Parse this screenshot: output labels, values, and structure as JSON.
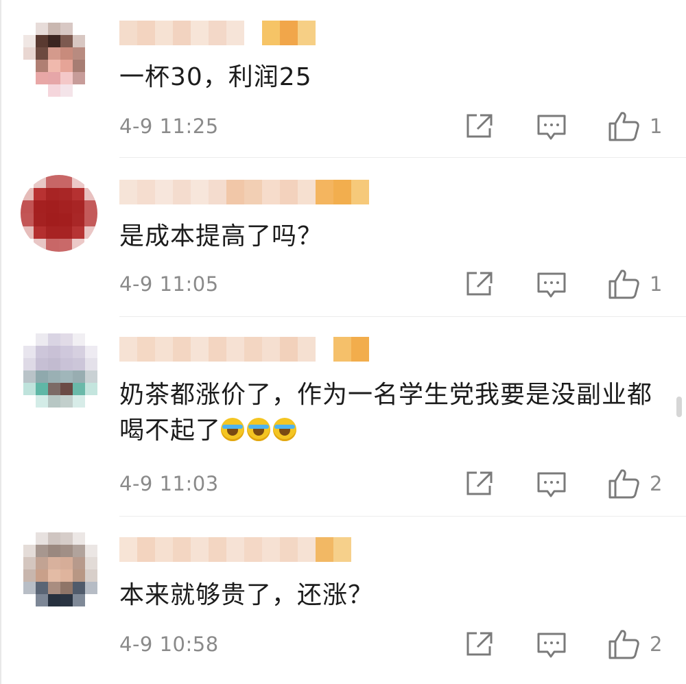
{
  "comments": [
    {
      "text": "一杯30，利润25",
      "time": "4-9 11:25",
      "likes": "1",
      "avatar_colors": [
        "#ffffff",
        "#e7dcd9",
        "#c9b7b0",
        "#d8c8c4",
        "#ffffff",
        "#ffffff",
        "#f0e7e4",
        "#5a3a31",
        "#3b2520",
        "#7d5a50",
        "#d8c7c2",
        "#ffffff",
        "#e9d7d2",
        "#6d4a40",
        "#d49a8c",
        "#c88b7c",
        "#b88b80",
        "#ffffff",
        "#ffffff",
        "#b07f73",
        "#f0b9ad",
        "#e6a497",
        "#a77d73",
        "#ffffff",
        "#ffffff",
        "#e8a7a6",
        "#e6a6a8",
        "#f4c8c8",
        "#c79c99",
        "#ffffff",
        "#ffffff",
        "#ffffff",
        "#f5d6dc",
        "#f4e4e9",
        "#ffffff",
        "#ffffff"
      ],
      "name_colors": [
        "#f4dccb",
        "#f3d4c0",
        "#f6e2d3",
        "#f2d3c0",
        "#f7e5d8",
        "#f3d8c8",
        "#f6e4d8",
        "#ffffff",
        "#f6c466",
        "#f1a64a",
        "#f6cf85"
      ]
    },
    {
      "text": "是成本提高了吗？",
      "time": "4-9 11:05",
      "likes": "1",
      "avatar_colors": [
        "#ffffff",
        "#e8c8c6",
        "#c76666",
        "#c86666",
        "#ecc9c8",
        "#ffffff",
        "#e5bbb8",
        "#b83232",
        "#a82424",
        "#a92626",
        "#b53131",
        "#e8c0bf",
        "#c25353",
        "#a52020",
        "#a31e1e",
        "#a52121",
        "#a82525",
        "#c45a5a",
        "#c35656",
        "#a52121",
        "#a21d1d",
        "#a31e1e",
        "#a92727",
        "#c45a5a",
        "#e6bdbb",
        "#b42f2f",
        "#a72323",
        "#a72323",
        "#b63434",
        "#eac6c5",
        "#ffffff",
        "#e8c6c5",
        "#c86767",
        "#c96969",
        "#ecc9c8",
        "#ffffff"
      ],
      "name_colors": [
        "#f6e4d8",
        "#f5ddcf",
        "#f7e6dc",
        "#f4dcce",
        "#f7e6db",
        "#f4dcce",
        "#f1c7a8",
        "#f2cfb4",
        "#f6dccb",
        "#f3d2bd",
        "#f6e0d0",
        "#f4b55f",
        "#f2ae4e",
        "#f6c97a"
      ]
    },
    {
      "text": "奶茶都涨价了，作为一名学生党我要是没副业都喝不起了",
      "emoji_count": 3,
      "time": "4-9 11:03",
      "likes": "2",
      "avatar_colors": [
        "#ffffff",
        "#eceaf0",
        "#d9d4e3",
        "#e1dbe7",
        "#f1eff3",
        "#ffffff",
        "#e8e5ee",
        "#cdc6da",
        "#c9c1d6",
        "#cfc8dc",
        "#d6d0e0",
        "#eeebf2",
        "#dedae6",
        "#c6bfd4",
        "#c2bbd0",
        "#c9c2d7",
        "#ccc6d9",
        "#e4e1ea",
        "#b9c3c8",
        "#8fa9ad",
        "#9ab0b4",
        "#a0b6ba",
        "#98adb1",
        "#c9d1d4",
        "#bfe3dc",
        "#5fb7a6",
        "#7c6a66",
        "#6b4a45",
        "#6ab9a9",
        "#c4e5de",
        "#ffffff",
        "#d3ece7",
        "#b7c7c4",
        "#c2cfcc",
        "#d7ece8",
        "#ffffff"
      ],
      "name_colors": [
        "#f6e2d4",
        "#f4d8c4",
        "#f6e1d2",
        "#f3d6c2",
        "#f6e3d6",
        "#f3d5c1",
        "#f6e1d3",
        "#f3d6c2",
        "#f5dfd0",
        "#f2d1bb",
        "#f5e0d1",
        "#ffffff",
        "#f5c06a",
        "#f2ad4c"
      ]
    },
    {
      "text": "本来就够贵了，还涨？",
      "time": "4-9 10:58",
      "likes": "2",
      "avatar_colors": [
        "#ffffff",
        "#e7e1df",
        "#cfc5c1",
        "#d6cdc9",
        "#ece7e5",
        "#ffffff",
        "#e4dcd8",
        "#a7978f",
        "#9a887f",
        "#a18f86",
        "#b1a39c",
        "#ebe6e4",
        "#d4c6bf",
        "#c2a393",
        "#d8b19d",
        "#d6ad98",
        "#b79a8c",
        "#e2dbd7",
        "#c8b6ad",
        "#c9a08a",
        "#e3bba5",
        "#dfb49d",
        "#b89784",
        "#d8cfca",
        "#b8bec6",
        "#5a6575",
        "#a98d80",
        "#8f7568",
        "#505b6b",
        "#b6bcc5",
        "#ffffff",
        "#7d8796",
        "#27313f",
        "#2a3442",
        "#7f8997",
        "#ffffff"
      ],
      "name_colors": [
        "#f7e4d6",
        "#f3d4bf",
        "#f6e0d0",
        "#f3d6c2",
        "#f6e2d4",
        "#f3d6c2",
        "#f6e2d5",
        "#f4d8c6",
        "#f6e1d3",
        "#f3d7c4",
        "#f6e2d4",
        "#f2b864",
        "#f6d08b"
      ]
    }
  ]
}
